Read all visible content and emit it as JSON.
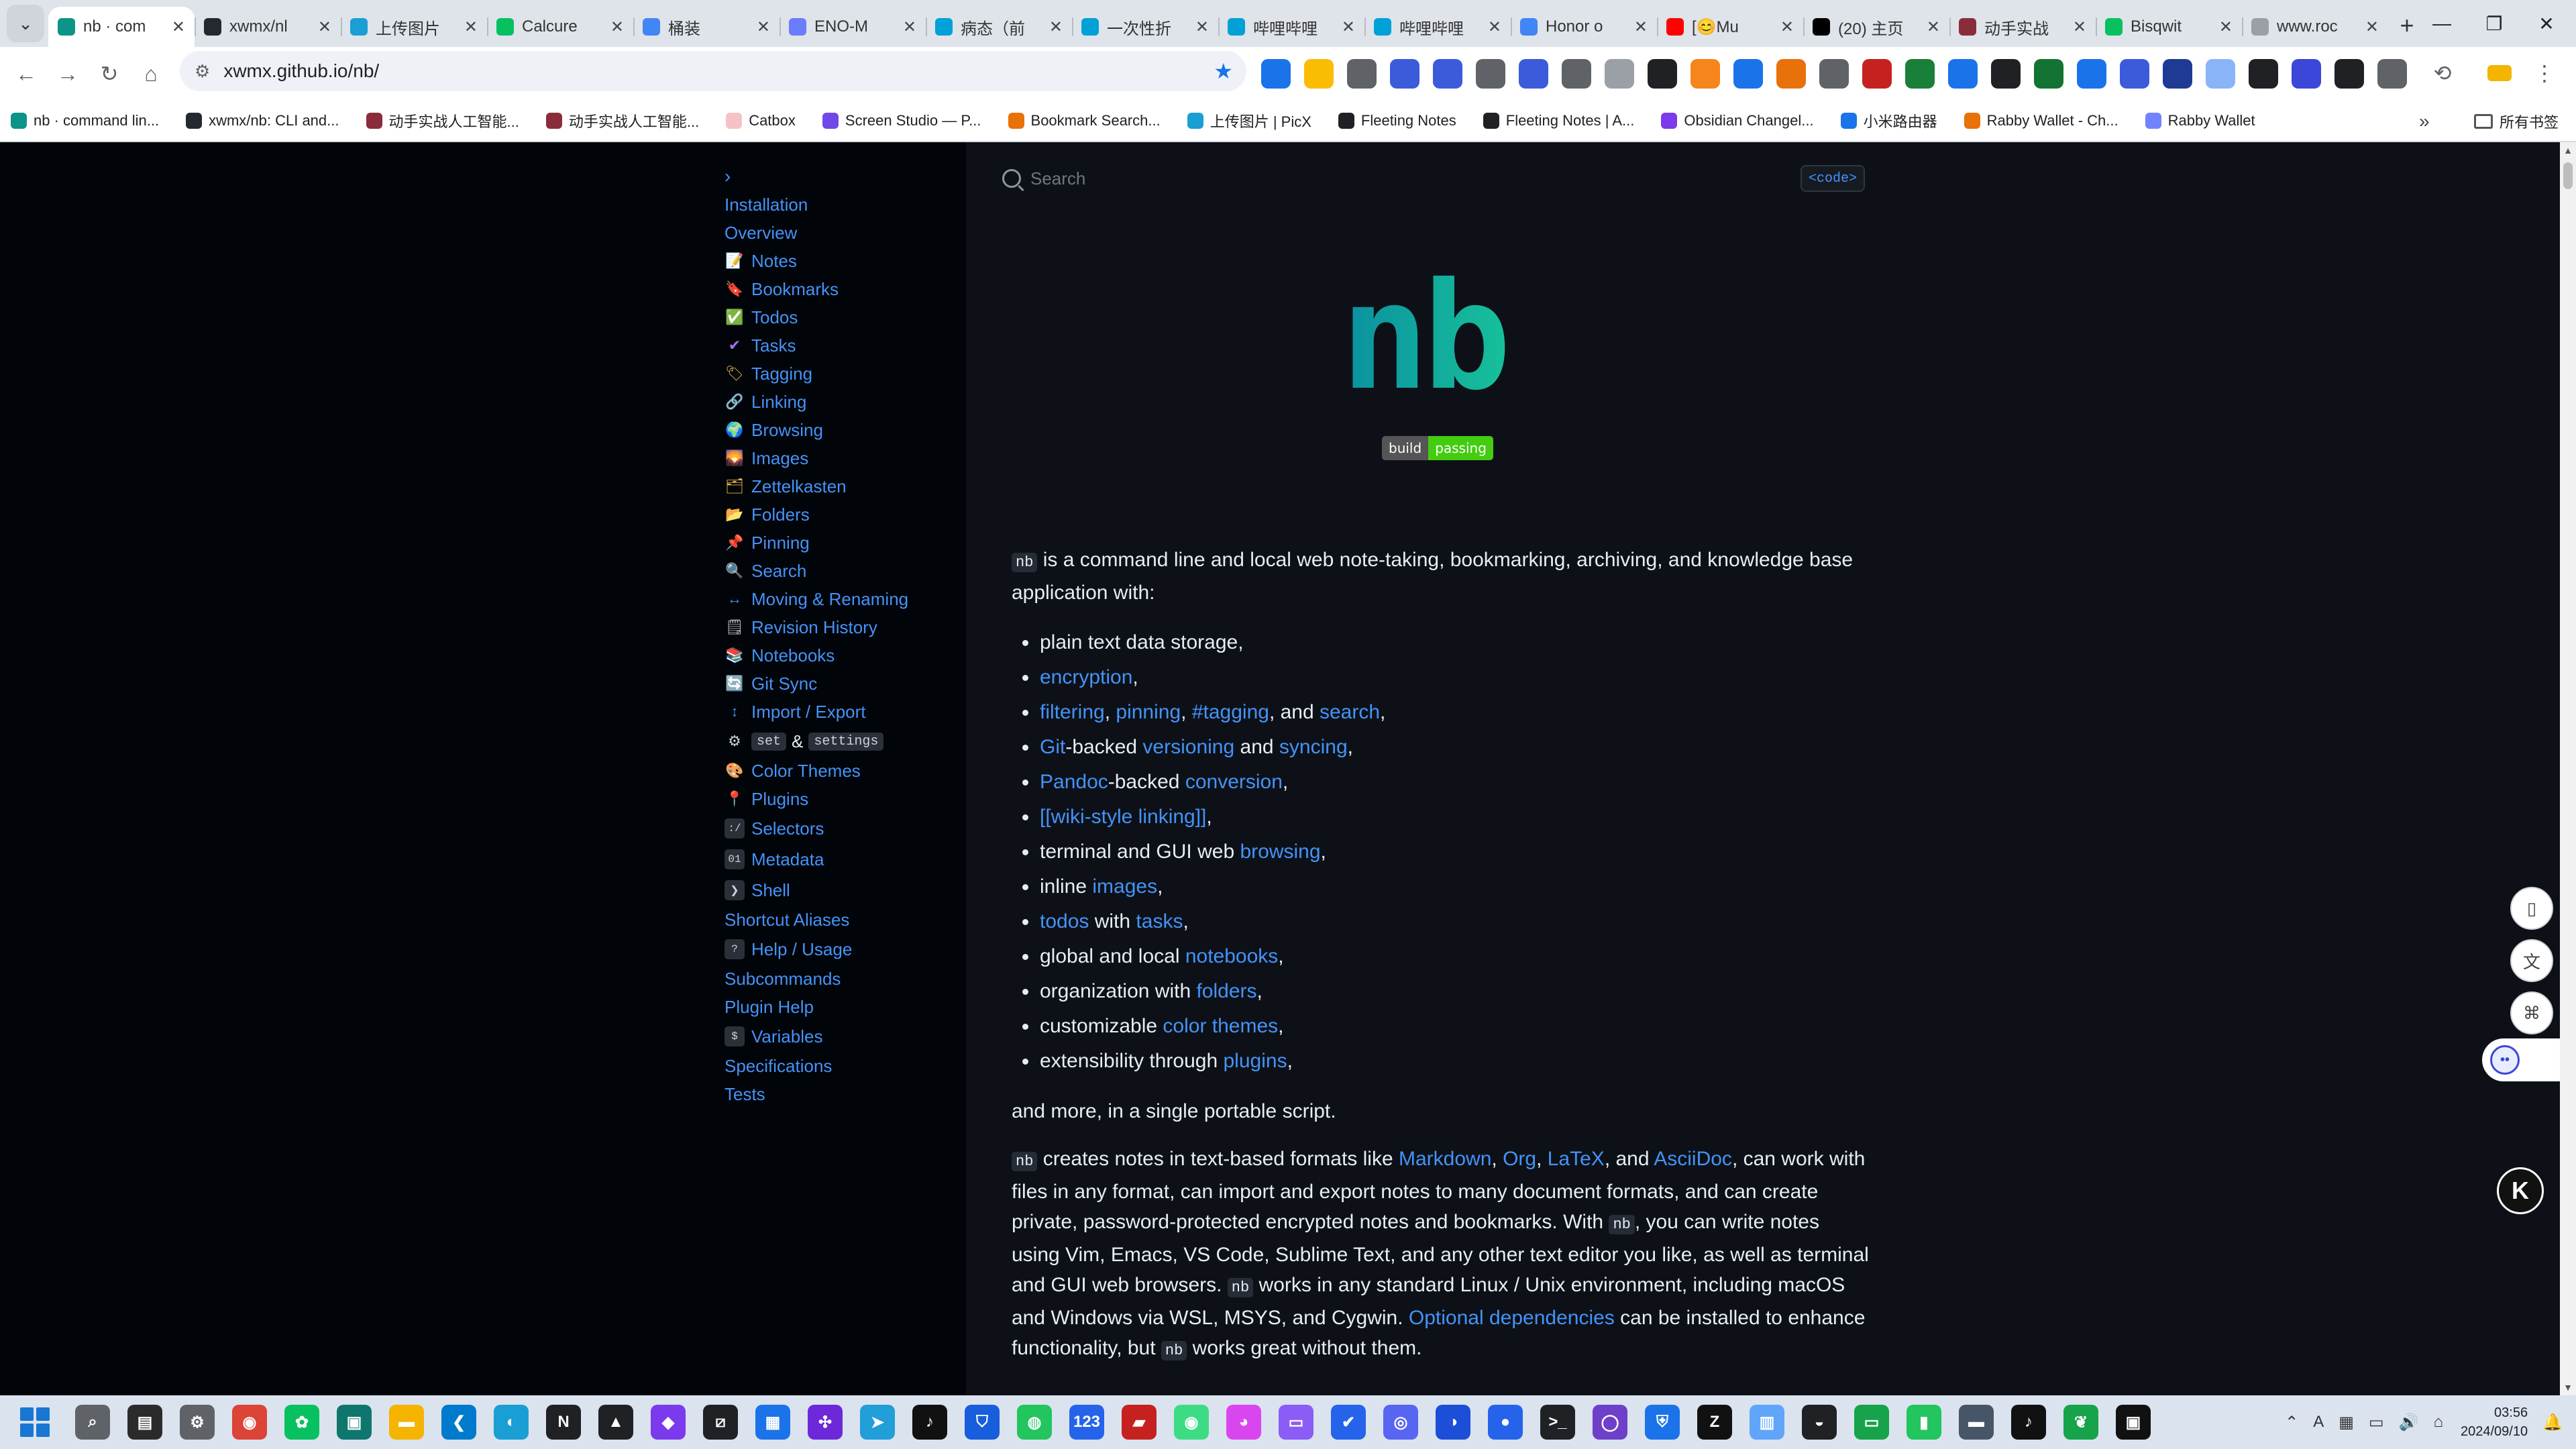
{
  "browser": {
    "tabs": [
      {
        "title": "nb · com",
        "favicon_color": "#0d9488",
        "active": true
      },
      {
        "title": "xwmx/nl",
        "favicon_color": "#24292f"
      },
      {
        "title": "上传图片",
        "favicon_color": "#1a9fd4"
      },
      {
        "title": "Calcure",
        "favicon_color": "#07c160"
      },
      {
        "title": "桶装",
        "favicon_color": "#4285f4"
      },
      {
        "title": "ENO-M",
        "favicon_color": "#6b7cff"
      },
      {
        "title": "病态（前",
        "favicon_color": "#00a1d6"
      },
      {
        "title": "一次性折",
        "favicon_color": "#00a1d6"
      },
      {
        "title": "哔哩哔哩",
        "favicon_color": "#00a1d6"
      },
      {
        "title": "哔哩哔哩",
        "favicon_color": "#00a1d6"
      },
      {
        "title": "Honor o",
        "favicon_color": "#4285f4"
      },
      {
        "title": "[😊Mu",
        "favicon_color": "#ff0000"
      },
      {
        "title": "(20) 主页",
        "favicon_color": "#000000"
      },
      {
        "title": "动手实战",
        "favicon_color": "#8a2d3b"
      },
      {
        "title": "Bisqwit",
        "favicon_color": "#07c160"
      },
      {
        "title": "www.roc",
        "favicon_color": "#9aa0a6"
      }
    ],
    "window_controls": {
      "minimize": "—",
      "restore": "❐",
      "close": "✕"
    },
    "address": {
      "url": "xwmx.github.io/nb/"
    },
    "extensions": [
      {
        "name": "blue-dot-ext",
        "color": "#1a73e8"
      },
      {
        "name": "star-ext",
        "color": "#fbbc04"
      },
      {
        "name": "trophy-ext",
        "color": "#5f6368"
      },
      {
        "name": "image-ext",
        "color": "#3b5bdb"
      },
      {
        "name": "screenshot-ext",
        "color": "#3b5bdb"
      },
      {
        "name": "cloud-ext",
        "color": "#5f6368"
      },
      {
        "name": "translate-ext",
        "color": "#3b5bdb"
      },
      {
        "name": "badge-ext",
        "color": "#5f6368"
      },
      {
        "name": "undo-ext",
        "color": "#9aa0a6"
      },
      {
        "name": "mask-ext",
        "color": "#202124"
      },
      {
        "name": "metamask-ext",
        "color": "#f6851b"
      },
      {
        "name": "y-ext",
        "color": "#1a73e8"
      },
      {
        "name": "orange-ring-ext",
        "color": "#e8710a"
      },
      {
        "name": "eye-ext",
        "color": "#5f6368"
      },
      {
        "name": "red-badge-ext",
        "color": "#c5221f"
      },
      {
        "name": "green-ext",
        "color": "#188038"
      },
      {
        "name": "chart-ext",
        "color": "#1a73e8"
      },
      {
        "name": "k-black-ext",
        "color": "#202124"
      },
      {
        "name": "bookmark-ext",
        "color": "#137333"
      },
      {
        "name": "k-blue-ext",
        "color": "#1a73e8"
      },
      {
        "name": "face-ext",
        "color": "#3b5bdb"
      },
      {
        "name": "square-ext",
        "color": "#1f3a93"
      },
      {
        "name": "cloud2-ext",
        "color": "#8ab4f8"
      },
      {
        "name": "h-ext",
        "color": "#202124"
      },
      {
        "name": "bot-ext",
        "color": "#3b47d8"
      },
      {
        "name": "f-ext",
        "color": "#202124"
      },
      {
        "name": "puzzle-ext",
        "color": "#5f6368"
      }
    ],
    "bookmarks": [
      {
        "label": "nb · command lin...",
        "color": "#0d9488"
      },
      {
        "label": "xwmx/nb: CLI and...",
        "color": "#24292f"
      },
      {
        "label": "动手实战人工智能...",
        "color": "#8a2d3b"
      },
      {
        "label": "动手实战人工智能...",
        "color": "#8a2d3b"
      },
      {
        "label": "Catbox",
        "color": "#f5c2c7"
      },
      {
        "label": "Screen Studio — P...",
        "color": "#7048e8"
      },
      {
        "label": "Bookmark Search...",
        "color": "#e8710a"
      },
      {
        "label": "上传图片 | PicX",
        "color": "#1a9fd4"
      },
      {
        "label": "Fleeting Notes",
        "color": "#202124"
      },
      {
        "label": "Fleeting Notes | A...",
        "color": "#202124"
      },
      {
        "label": "Obsidian Changel...",
        "color": "#7c3aed"
      },
      {
        "label": "小米路由器",
        "color": "#1a73e8"
      },
      {
        "label": "Rabby Wallet - Ch...",
        "color": "#e8710a"
      },
      {
        "label": "Rabby Wallet",
        "color": "#7084ff"
      }
    ],
    "bookmarks_overflow": "»",
    "all_bookmarks": "所有书签"
  },
  "page": {
    "search_placeholder": "Search",
    "code_toggle": "<code>",
    "logo_text": "nb",
    "badge": {
      "left": "build",
      "right": "passing"
    },
    "sidebar": {
      "toggle": "›",
      "items": [
        {
          "label": "Installation",
          "icon": ""
        },
        {
          "label": "Overview",
          "icon": ""
        },
        {
          "label": "Notes",
          "icon": "📝"
        },
        {
          "label": "Bookmarks",
          "icon": "🔖"
        },
        {
          "label": "Todos",
          "icon": "✅"
        },
        {
          "label": "Tasks",
          "icon": "✔"
        },
        {
          "label": "Tagging",
          "icon": "🏷"
        },
        {
          "label": "Linking",
          "icon": "🔗"
        },
        {
          "label": "Browsing",
          "icon": "🌍"
        },
        {
          "label": "Images",
          "icon": "🌄"
        },
        {
          "label": "Zettelkasten",
          "icon": "🗂"
        },
        {
          "label": "Folders",
          "icon": "📂"
        },
        {
          "label": "Pinning",
          "icon": "📌"
        },
        {
          "label": "Search",
          "icon": "🔍"
        },
        {
          "label": "Moving & Renaming",
          "icon": "↔"
        },
        {
          "label": "Revision History",
          "icon": "🗒"
        },
        {
          "label": "Notebooks",
          "icon": "📚"
        },
        {
          "label": "Git Sync",
          "icon": "🔄"
        },
        {
          "label": "Import / Export",
          "icon": "↕"
        }
      ],
      "settings_item": {
        "icon": "⚙",
        "code1": "set",
        "amp": "&",
        "code2": "settings"
      },
      "items2": [
        {
          "label": "Color Themes",
          "icon": "🎨"
        },
        {
          "label": "Plugins",
          "icon": "📍"
        },
        {
          "label": "Selectors",
          "icon": ":/"
        },
        {
          "label": "Metadata",
          "icon": "01"
        },
        {
          "label": "Shell",
          "icon": "❯"
        },
        {
          "label": "Shortcut Aliases",
          "icon": ""
        },
        {
          "label": "Help / Usage",
          "icon": "?"
        },
        {
          "label": "Subcommands",
          "icon": ""
        },
        {
          "label": "Plugin Help",
          "icon": ""
        },
        {
          "label": "Variables",
          "icon": "$"
        },
        {
          "label": "Specifications",
          "icon": ""
        },
        {
          "label": "Tests",
          "icon": ""
        }
      ]
    },
    "intro": {
      "code": "nb",
      "text": " is a command line and local web note-taking, bookmarking, archiving, and knowledge base application with:"
    },
    "features": {
      "f1": "plain text data storage,",
      "f2_link": "encryption",
      "f2_tail": ",",
      "f3_l1": "filtering",
      "f3_s1": ", ",
      "f3_l2": "pinning",
      "f3_s2": ", ",
      "f3_l3": "#tagging",
      "f3_s3": ", and ",
      "f3_l4": "search",
      "f3_tail": ",",
      "f4_l1": "Git",
      "f4_s1": "-backed ",
      "f4_l2": "versioning",
      "f4_s2": " and ",
      "f4_l3": "syncing",
      "f4_tail": ",",
      "f5_l1": "Pandoc",
      "f5_s1": "-backed ",
      "f5_l2": "conversion",
      "f5_tail": ",",
      "f6_link": "[[wiki-style linking]]",
      "f6_tail": ",",
      "f7_head": "terminal and GUI web ",
      "f7_link": "browsing",
      "f7_tail": ",",
      "f8_head": "inline ",
      "f8_link": "images",
      "f8_tail": ",",
      "f9_l1": "todos",
      "f9_s1": " with ",
      "f9_l2": "tasks",
      "f9_tail": ",",
      "f10_head": "global and local ",
      "f10_link": "notebooks",
      "f10_tail": ",",
      "f11_head": "organization with ",
      "f11_link": "folders",
      "f11_tail": ",",
      "f12_head": "customizable ",
      "f12_link": "color themes",
      "f12_tail": ",",
      "f13_head": "extensibility through ",
      "f13_link": "plugins",
      "f13_tail": ","
    },
    "more_text": "and more, in a single portable script.",
    "para2": {
      "c1": "nb",
      "t1": " creates notes in text-based formats like ",
      "l1": "Markdown",
      "s1": ", ",
      "l2": "Org",
      "s2": ", ",
      "l3": "LaTeX",
      "s3": ", and ",
      "l4": "AsciiDoc",
      "t2": ", can work with files in any format, can import and export notes to many document formats, and can create private, password-protected encrypted notes and bookmarks. With ",
      "c2": "nb",
      "t3": ", you can write notes using Vim, Emacs, VS Code, Sublime Text, and any other text editor you like, as well as terminal and GUI web browsers. ",
      "c3": "nb",
      "t4": " works in any standard Linux / Unix environment, including macOS and Windows via WSL, MSYS, and Cygwin. ",
      "l5": "Optional dependencies",
      "t5": " can be installed to enhance functionality, but ",
      "c4": "nb",
      "t6": " works great without them."
    }
  },
  "taskbar": {
    "apps": [
      {
        "name": "search",
        "color": "#5f6368",
        "glyph": "⌕"
      },
      {
        "name": "file-manager",
        "color": "#2b2b2b",
        "glyph": "▤"
      },
      {
        "name": "settings",
        "color": "#5f6368",
        "glyph": "⚙"
      },
      {
        "name": "chrome",
        "color": "#db4437",
        "glyph": "◉"
      },
      {
        "name": "wechat",
        "color": "#07c160",
        "glyph": "✿"
      },
      {
        "name": "app-teal",
        "color": "#0f766e",
        "glyph": "▣"
      },
      {
        "name": "explorer",
        "color": "#f4b400",
        "glyph": "▬"
      },
      {
        "name": "vscode",
        "color": "#007acc",
        "glyph": "❮"
      },
      {
        "name": "app-circle",
        "color": "#1a9fd4",
        "glyph": "◐"
      },
      {
        "name": "notion",
        "color": "#202124",
        "glyph": "N"
      },
      {
        "name": "app-dark",
        "color": "#202124",
        "glyph": "▲"
      },
      {
        "name": "obsidian",
        "color": "#7c3aed",
        "glyph": "◆"
      },
      {
        "name": "app-slash",
        "color": "#202124",
        "glyph": "⧄"
      },
      {
        "name": "store",
        "color": "#1a73e8",
        "glyph": "▦"
      },
      {
        "name": "app-dots",
        "color": "#6d28d9",
        "glyph": "✣"
      },
      {
        "name": "telegram",
        "color": "#229ed9",
        "glyph": "➤"
      },
      {
        "name": "tiktok",
        "color": "#111111",
        "glyph": "♪"
      },
      {
        "name": "bitwarden",
        "color": "#175ddc",
        "glyph": "⛉"
      },
      {
        "name": "app-green",
        "color": "#22c55e",
        "glyph": "◍"
      },
      {
        "name": "num-123",
        "color": "#2563eb",
        "glyph": "123"
      },
      {
        "name": "app-red",
        "color": "#c5221f",
        "glyph": "▰"
      },
      {
        "name": "android",
        "color": "#3ddc84",
        "glyph": "◉"
      },
      {
        "name": "app-pink",
        "color": "#d946ef",
        "glyph": "◕"
      },
      {
        "name": "folder-purple",
        "color": "#8b5cf6",
        "glyph": "▭"
      },
      {
        "name": "todo",
        "color": "#2563eb",
        "glyph": "✔"
      },
      {
        "name": "discord",
        "color": "#5865f2",
        "glyph": "◎"
      },
      {
        "name": "app-blue",
        "color": "#1d4ed8",
        "glyph": "◑"
      },
      {
        "name": "app-navy",
        "color": "#2563eb",
        "glyph": "●"
      },
      {
        "name": "terminal",
        "color": "#202124",
        "glyph": ">_"
      },
      {
        "name": "github",
        "color": "#6e40c9",
        "glyph": "◯"
      },
      {
        "name": "app-shield",
        "color": "#1a73e8",
        "glyph": "⛨"
      },
      {
        "name": "zed",
        "color": "#111111",
        "glyph": "Z"
      },
      {
        "name": "notepad",
        "color": "#60a5fa",
        "glyph": "▥"
      },
      {
        "name": "obs",
        "color": "#202124",
        "glyph": "◒"
      },
      {
        "name": "app-screen",
        "color": "#16a34a",
        "glyph": "▭"
      },
      {
        "name": "app-green2",
        "color": "#22c55e",
        "glyph": "▮"
      },
      {
        "name": "app-bar",
        "color": "#475569",
        "glyph": "▬"
      },
      {
        "name": "tiktok2",
        "color": "#111111",
        "glyph": "♪"
      },
      {
        "name": "app-leaf",
        "color": "#16a34a",
        "glyph": "❦"
      },
      {
        "name": "app-box",
        "color": "#111111",
        "glyph": "▣"
      }
    ],
    "tray": [
      "⌃",
      "A",
      "▦",
      "▭",
      "🔊",
      "⌂"
    ],
    "time": "03:56",
    "date": "2024/09/10",
    "notification": "🔔"
  }
}
